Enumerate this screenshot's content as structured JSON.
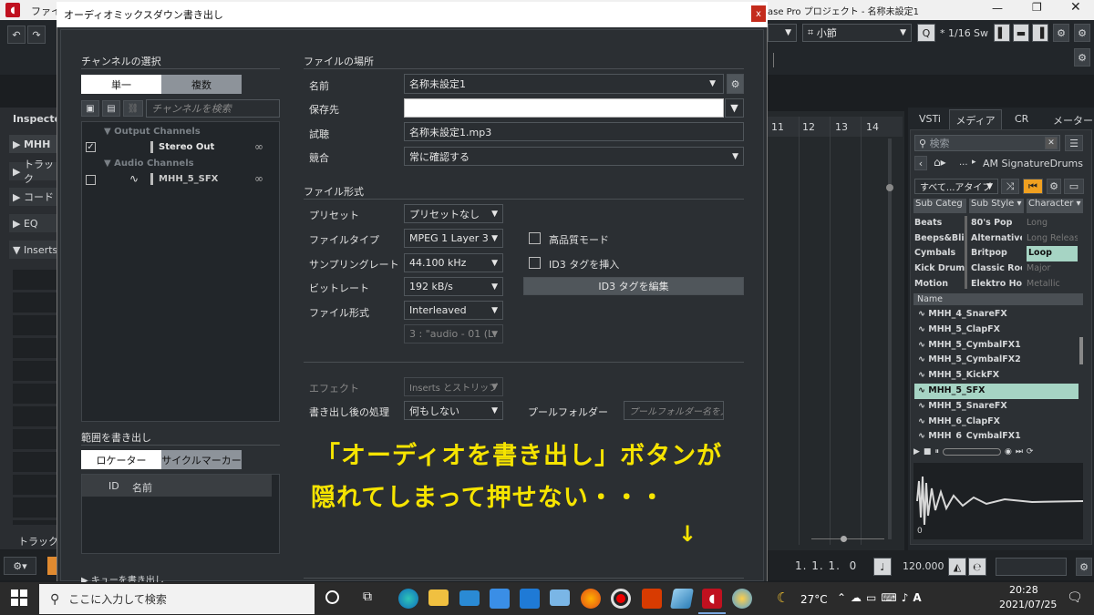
{
  "app": {
    "menu_file": "ファイル",
    "title": "ase Pro プロジェクト - 名称未設定1",
    "quantize": "小節",
    "grid": "* 1/16",
    "sw": "Sw",
    "inspector": "Inspector",
    "track_header": "MHH",
    "inspector_items": [
      "トラック",
      "コード",
      "EQ",
      "Inserts"
    ],
    "track_tab": "トラック",
    "ruler": [
      "11",
      "12",
      "13",
      "14"
    ],
    "position": "1. 1. 1.  0",
    "tempo": "120.000",
    "clock": "20:28",
    "date": "2021/07/25"
  },
  "media": {
    "tabs": [
      "VSTi",
      "メディア",
      "CR",
      "メーター"
    ],
    "search_placeholder": "検索",
    "path_dots": "...",
    "path": "AM SignatureDrums",
    "type_filter": "すべて...アタイプ",
    "columns": [
      "Sub Categ",
      "Sub Style",
      "Character"
    ],
    "col1": [
      "Beats",
      "Beeps&Blip",
      "Cymbals",
      "Kick Drum",
      "Motion"
    ],
    "col2": [
      "80's Pop",
      "Alternative",
      "Britpop",
      "Classic Roc",
      "Elektro Hou"
    ],
    "col3": [
      "Long",
      "Long Releas",
      "Loop",
      "Major",
      "Metallic"
    ],
    "name_header": "Name",
    "files": [
      "MHH_4_SnareFX",
      "MHH_5_ClapFX",
      "MHH_5_CymbalFX1",
      "MHH_5_CymbalFX2",
      "MHH_5_KickFX",
      "MHH_5_SFX",
      "MHH_5_SnareFX",
      "MHH_6_ClapFX",
      "MHH_6_CymbalFX1"
    ],
    "wave_label": "0"
  },
  "dialog": {
    "title": "オーディオミックスダウン書き出し",
    "close": "x",
    "channel_section": "チャンネルの選択",
    "single": "単一",
    "multi": "複数",
    "search_placeholder": "チャンネルを検索",
    "output_group": "Output Channels",
    "stereo_out": "Stereo Out",
    "audio_group": "Audio Channels",
    "track_name": "MHH_5_SFX",
    "range_section": "範囲を書き出し",
    "locator": "ロケーター",
    "cycle": "サイクルマーカー",
    "col_id": "ID",
    "col_name": "名前",
    "queue": "キューを書き出し",
    "file_location": "ファイルの場所",
    "name_label": "名前",
    "name_value": "名称未設定1",
    "path_label": "保存先",
    "path_value": "",
    "trial_label": "試聴",
    "trial_value": "名称未設定1.mp3",
    "conflict_label": "競合",
    "conflict_value": "常に確認する",
    "format_section": "ファイル形式",
    "preset_label": "プリセット",
    "preset_value": "プリセットなし",
    "filetype_label": "ファイルタイプ",
    "filetype_value": "MPEG 1 Layer 3",
    "hq_label": "高品質モード",
    "samplerate_label": "サンプリングレート",
    "samplerate_value": "44.100 kHz",
    "id3_label": "ID3 タグを挿入",
    "bitrate_label": "ビットレート",
    "bitrate_value": "192 kB/s",
    "id3_edit": "ID3 タグを編集",
    "fileformat_label": "ファイル形式",
    "fileformat_value": "Interleaved",
    "channel_value": "3 : \"audio - 01 (L.",
    "effect_label": "エフェクト",
    "effect_value": "Inserts とストリップ",
    "after_label": "書き出し後の処理",
    "after_value": "何もしない",
    "pool_label": "プールフォルダー",
    "pool_placeholder": "プールフォルダー名を入."
  },
  "annotation": {
    "line1": "「オーディオを書き出し」ボタンが",
    "line2": "隠れてしまって押せない・・・",
    "arrow": "↓",
    "color": "#f6e400"
  },
  "taskbar": {
    "search_placeholder": "ここに入力して検索",
    "weather": "27°C"
  }
}
